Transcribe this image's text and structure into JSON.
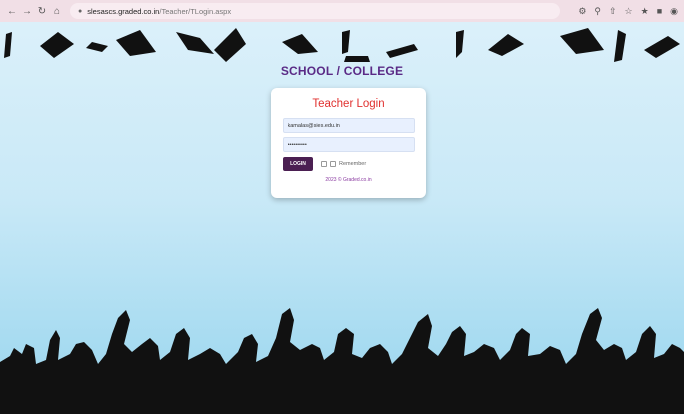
{
  "browser": {
    "url_host": "slesascs.graded.co.in",
    "url_path": "/Teacher/TLogin.aspx",
    "nav_icons": [
      "back-icon",
      "forward-icon",
      "reload-icon",
      "home-icon"
    ],
    "right_icons": [
      "key-icon",
      "zoom-icon",
      "share-icon",
      "star-icon",
      "extensions-icon",
      "sidebar-icon",
      "profile-icon"
    ]
  },
  "site": {
    "title": "SCHOOL / COLLEGE"
  },
  "login": {
    "heading": "Teacher Login",
    "email_value": "kamalas@sies.edu.in",
    "password_value": "••••••••••",
    "button_label": "LOGIN",
    "remember_label": "Remember",
    "copyright": "2023 © Graded.co.in"
  },
  "colors": {
    "accent_purple": "#5a2a86",
    "heading_red": "#e0312f",
    "button_bg": "#4b1f52",
    "field_bg": "#e8f0fe"
  }
}
